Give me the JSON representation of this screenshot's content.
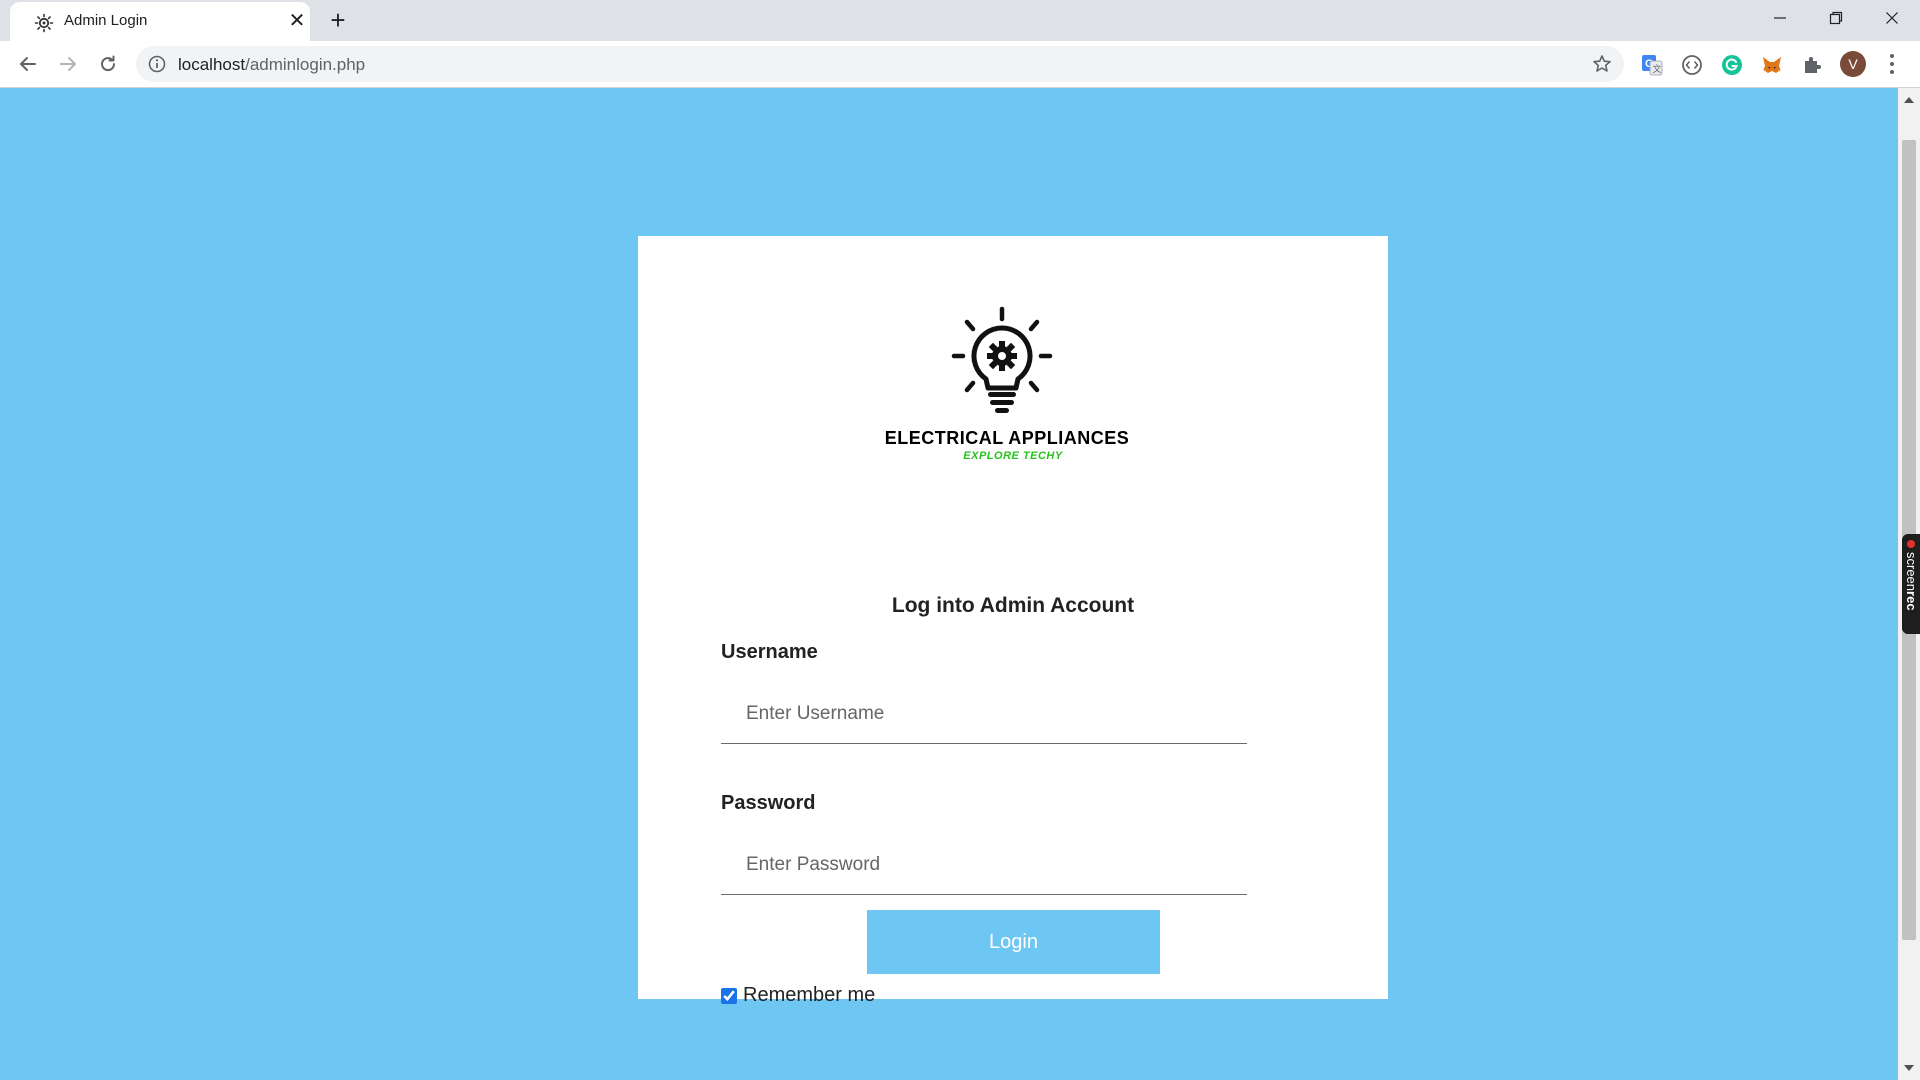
{
  "browser": {
    "tab_title": "Admin Login",
    "tab_close": "✕",
    "new_tab": "+",
    "url_host": "localhost",
    "url_path": "/adminlogin.php",
    "avatar_letter": "V",
    "window_minimize": "—",
    "window_restore": "❐",
    "window_close": "✕"
  },
  "extensions": [
    "google-translate-icon",
    "dev-tools-icon",
    "grammarly-icon",
    "metamask-icon",
    "puzzle-extensions-icon"
  ],
  "screenrec": {
    "label_light": "screen",
    "label_bold": "rec"
  },
  "logo": {
    "title": "ELECTRICAL APPLIANCES",
    "tagline": "EXPLORE TECHY"
  },
  "login": {
    "heading": "Log into Admin Account",
    "username_label": "Username",
    "username_placeholder": "Enter Username",
    "password_label": "Password",
    "password_placeholder": "Enter Password",
    "submit_label": "Login",
    "remember_label": "Remember me",
    "remember_checked": true
  },
  "colors": {
    "page_background": "#6ec6f2",
    "button_background": "#6ec6f2",
    "tagline": "#26c21b",
    "card": "#ffffff"
  }
}
